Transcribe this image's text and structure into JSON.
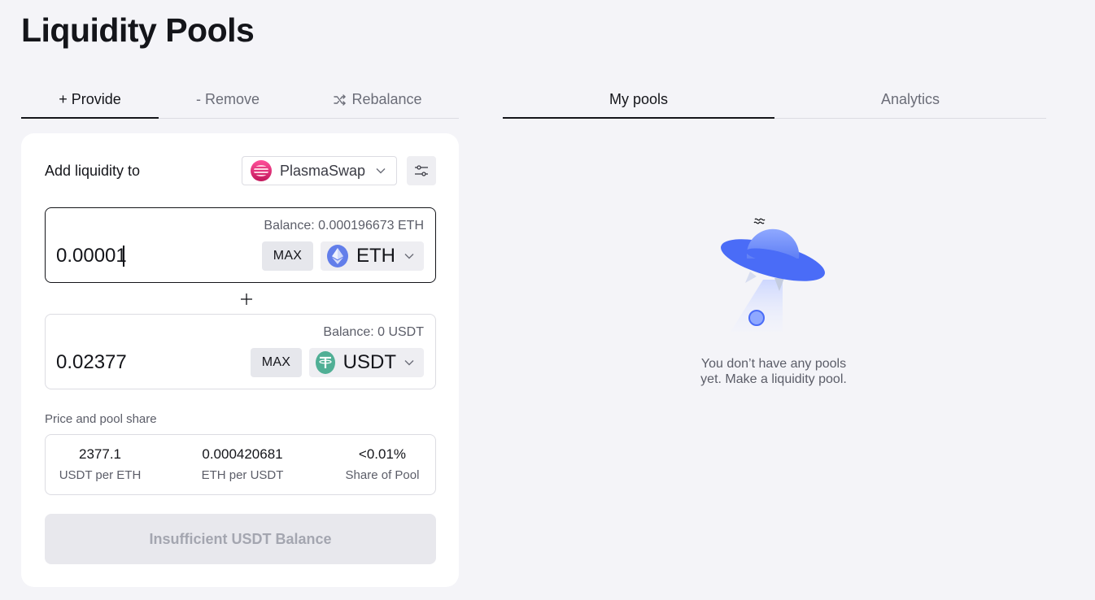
{
  "page": {
    "title": "Liquidity Pools"
  },
  "left_tabs": [
    {
      "label": "+ Provide",
      "active": true
    },
    {
      "label": "- Remove",
      "active": false
    },
    {
      "label": "Rebalance",
      "icon": "shuffle-icon",
      "active": false
    }
  ],
  "right_tabs": [
    {
      "label": "My pools",
      "active": true
    },
    {
      "label": "Analytics",
      "active": false
    }
  ],
  "add_liquidity": {
    "label": "Add liquidity to",
    "dex": {
      "name": "PlasmaSwap",
      "icon": "plasmaswap-logo"
    },
    "settings_icon": "sliders-icon"
  },
  "token_a": {
    "balance": "Balance: 0.000196673 ETH",
    "amount": "0.00001",
    "max_label": "MAX",
    "symbol": "ETH",
    "icon": "eth-icon"
  },
  "token_b": {
    "balance": "Balance: 0 USDT",
    "amount": "0.02377",
    "max_label": "MAX",
    "symbol": "USDT",
    "icon": "usdt-icon"
  },
  "price_share": {
    "label": "Price and pool share",
    "stats": [
      {
        "value": "2377.1",
        "label": "USDT per ETH"
      },
      {
        "value": "0.000420681",
        "label": "ETH per USDT"
      },
      {
        "value": "<0.01%",
        "label": "Share of Pool"
      }
    ]
  },
  "submit": {
    "label": "Insufficient USDT Balance",
    "disabled": true
  },
  "empty_state": {
    "illustration": "ufo-illustration",
    "line1": "You don’t have any pools",
    "line2": "yet. Make a liquidity pool."
  },
  "colors": {
    "background": "#f4f4f8",
    "eth": "#627eea",
    "usdt": "#50af95",
    "ufo": "#4a6cf7"
  }
}
